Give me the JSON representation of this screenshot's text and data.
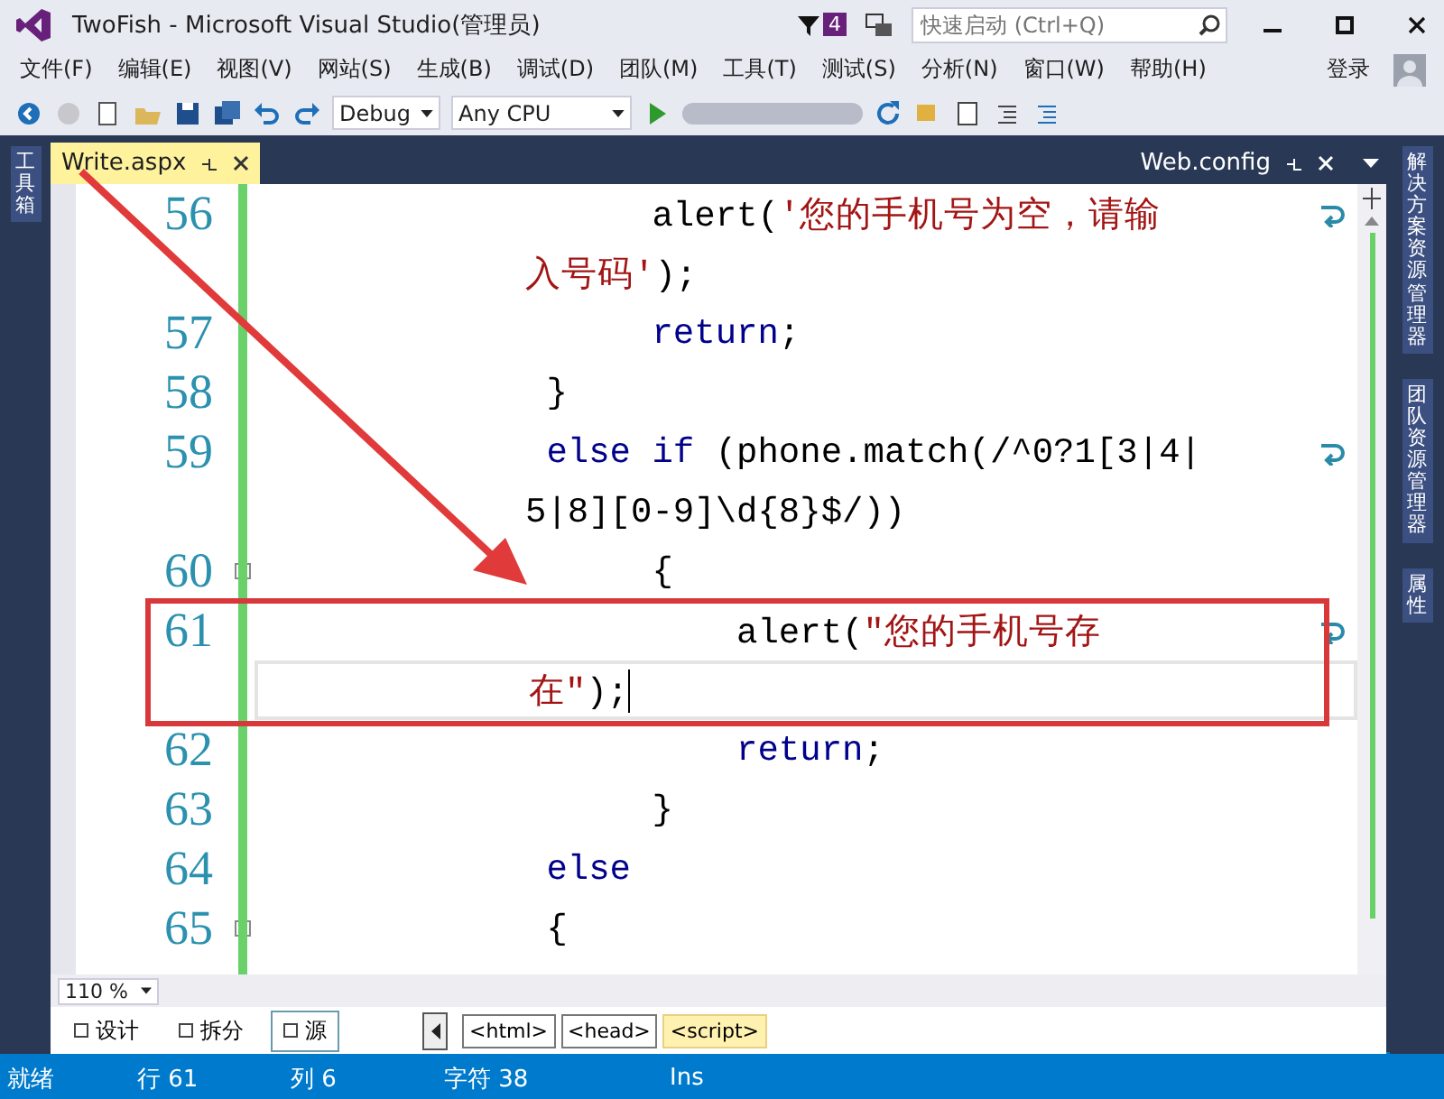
{
  "window": {
    "title": "TwoFish - Microsoft Visual Studio(管理员)",
    "notification_count": "4",
    "quick_launch": {
      "placeholder": "快速启动 (Ctrl+Q)"
    }
  },
  "menu": [
    "文件(F)",
    "编辑(E)",
    "视图(V)",
    "网站(S)",
    "生成(B)",
    "调试(D)",
    "团队(M)",
    "工具(T)",
    "测试(S)",
    "分析(N)",
    "窗口(W)",
    "帮助(H)"
  ],
  "sign_in": "登录",
  "toolbar": {
    "configuration": "Debug",
    "platform": "Any CPU"
  },
  "left_panels": [
    "工具箱"
  ],
  "right_panels": [
    "解决方案资源管理器",
    "团队资源管理器",
    "属性"
  ],
  "tabs": [
    {
      "label": "Write.aspx",
      "selected": true
    },
    {
      "label": "Web.config",
      "selected": false
    }
  ],
  "lines": [
    {
      "number": "56",
      "fold": false,
      "current": false,
      "rows": [
        {
          "segments": [
            {
              "kind": "plain",
              "text": "      alert("
            },
            {
              "kind": "string",
              "text": "'您的手机号为空，请输"
            }
          ]
        },
        {
          "segments": [
            {
              "kind": "string",
              "text": "入号码'"
            },
            {
              "kind": "plain",
              "text": ");"
            }
          ]
        }
      ]
    },
    {
      "number": "57",
      "fold": false,
      "current": false,
      "rows": [
        {
          "segments": [
            {
              "kind": "keyword",
              "text": "      return"
            },
            {
              "kind": "plain",
              "text": ";"
            }
          ]
        }
      ]
    },
    {
      "number": "58",
      "fold": false,
      "current": false,
      "rows": [
        {
          "segments": [
            {
              "kind": "plain",
              "text": " }"
            }
          ]
        }
      ]
    },
    {
      "number": "59",
      "fold": false,
      "current": false,
      "rows": [
        {
          "segments": [
            {
              "kind": "keyword",
              "text": " else if"
            },
            {
              "kind": "plain",
              "text": " (phone.match(/^0?1[3|4|"
            }
          ]
        },
        {
          "segments": [
            {
              "kind": "plain",
              "text": "5|8][0-9]\\d{8}$/))"
            }
          ]
        }
      ]
    },
    {
      "number": "60",
      "fold": true,
      "current": false,
      "rows": [
        {
          "segments": [
            {
              "kind": "plain",
              "text": "      {"
            }
          ]
        }
      ]
    },
    {
      "number": "61",
      "fold": false,
      "current": true,
      "rows": [
        {
          "segments": [
            {
              "kind": "plain",
              "text": "          alert("
            },
            {
              "kind": "string",
              "text": "\"您的手机号存"
            }
          ]
        },
        {
          "segments": [
            {
              "kind": "string",
              "text": "在\""
            },
            {
              "kind": "plain",
              "text": ");"
            }
          ]
        }
      ]
    },
    {
      "number": "62",
      "fold": false,
      "current": false,
      "rows": [
        {
          "segments": [
            {
              "kind": "keyword",
              "text": "          return"
            },
            {
              "kind": "plain",
              "text": ";"
            }
          ]
        }
      ]
    },
    {
      "number": "63",
      "fold": false,
      "current": false,
      "rows": [
        {
          "segments": [
            {
              "kind": "plain",
              "text": "      }"
            }
          ]
        }
      ]
    },
    {
      "number": "64",
      "fold": false,
      "current": false,
      "rows": [
        {
          "segments": [
            {
              "kind": "keyword",
              "text": " else"
            }
          ]
        }
      ]
    },
    {
      "number": "65",
      "fold": true,
      "current": false,
      "rows": [
        {
          "segments": [
            {
              "kind": "plain",
              "text": " {"
            }
          ]
        }
      ]
    }
  ],
  "zoom": "110 %",
  "views": [
    {
      "label": "设计",
      "selected": false
    },
    {
      "label": "拆分",
      "selected": false
    },
    {
      "label": "源",
      "selected": true
    }
  ],
  "tag_path": [
    {
      "label": "<html>",
      "selected": false
    },
    {
      "label": "<head>",
      "selected": false
    },
    {
      "label": "<script>",
      "selected": true
    }
  ],
  "status_bar": {
    "state": "就绪",
    "line": "行 61",
    "column": "列 6",
    "char": "字符 38",
    "mode": "Ins"
  }
}
